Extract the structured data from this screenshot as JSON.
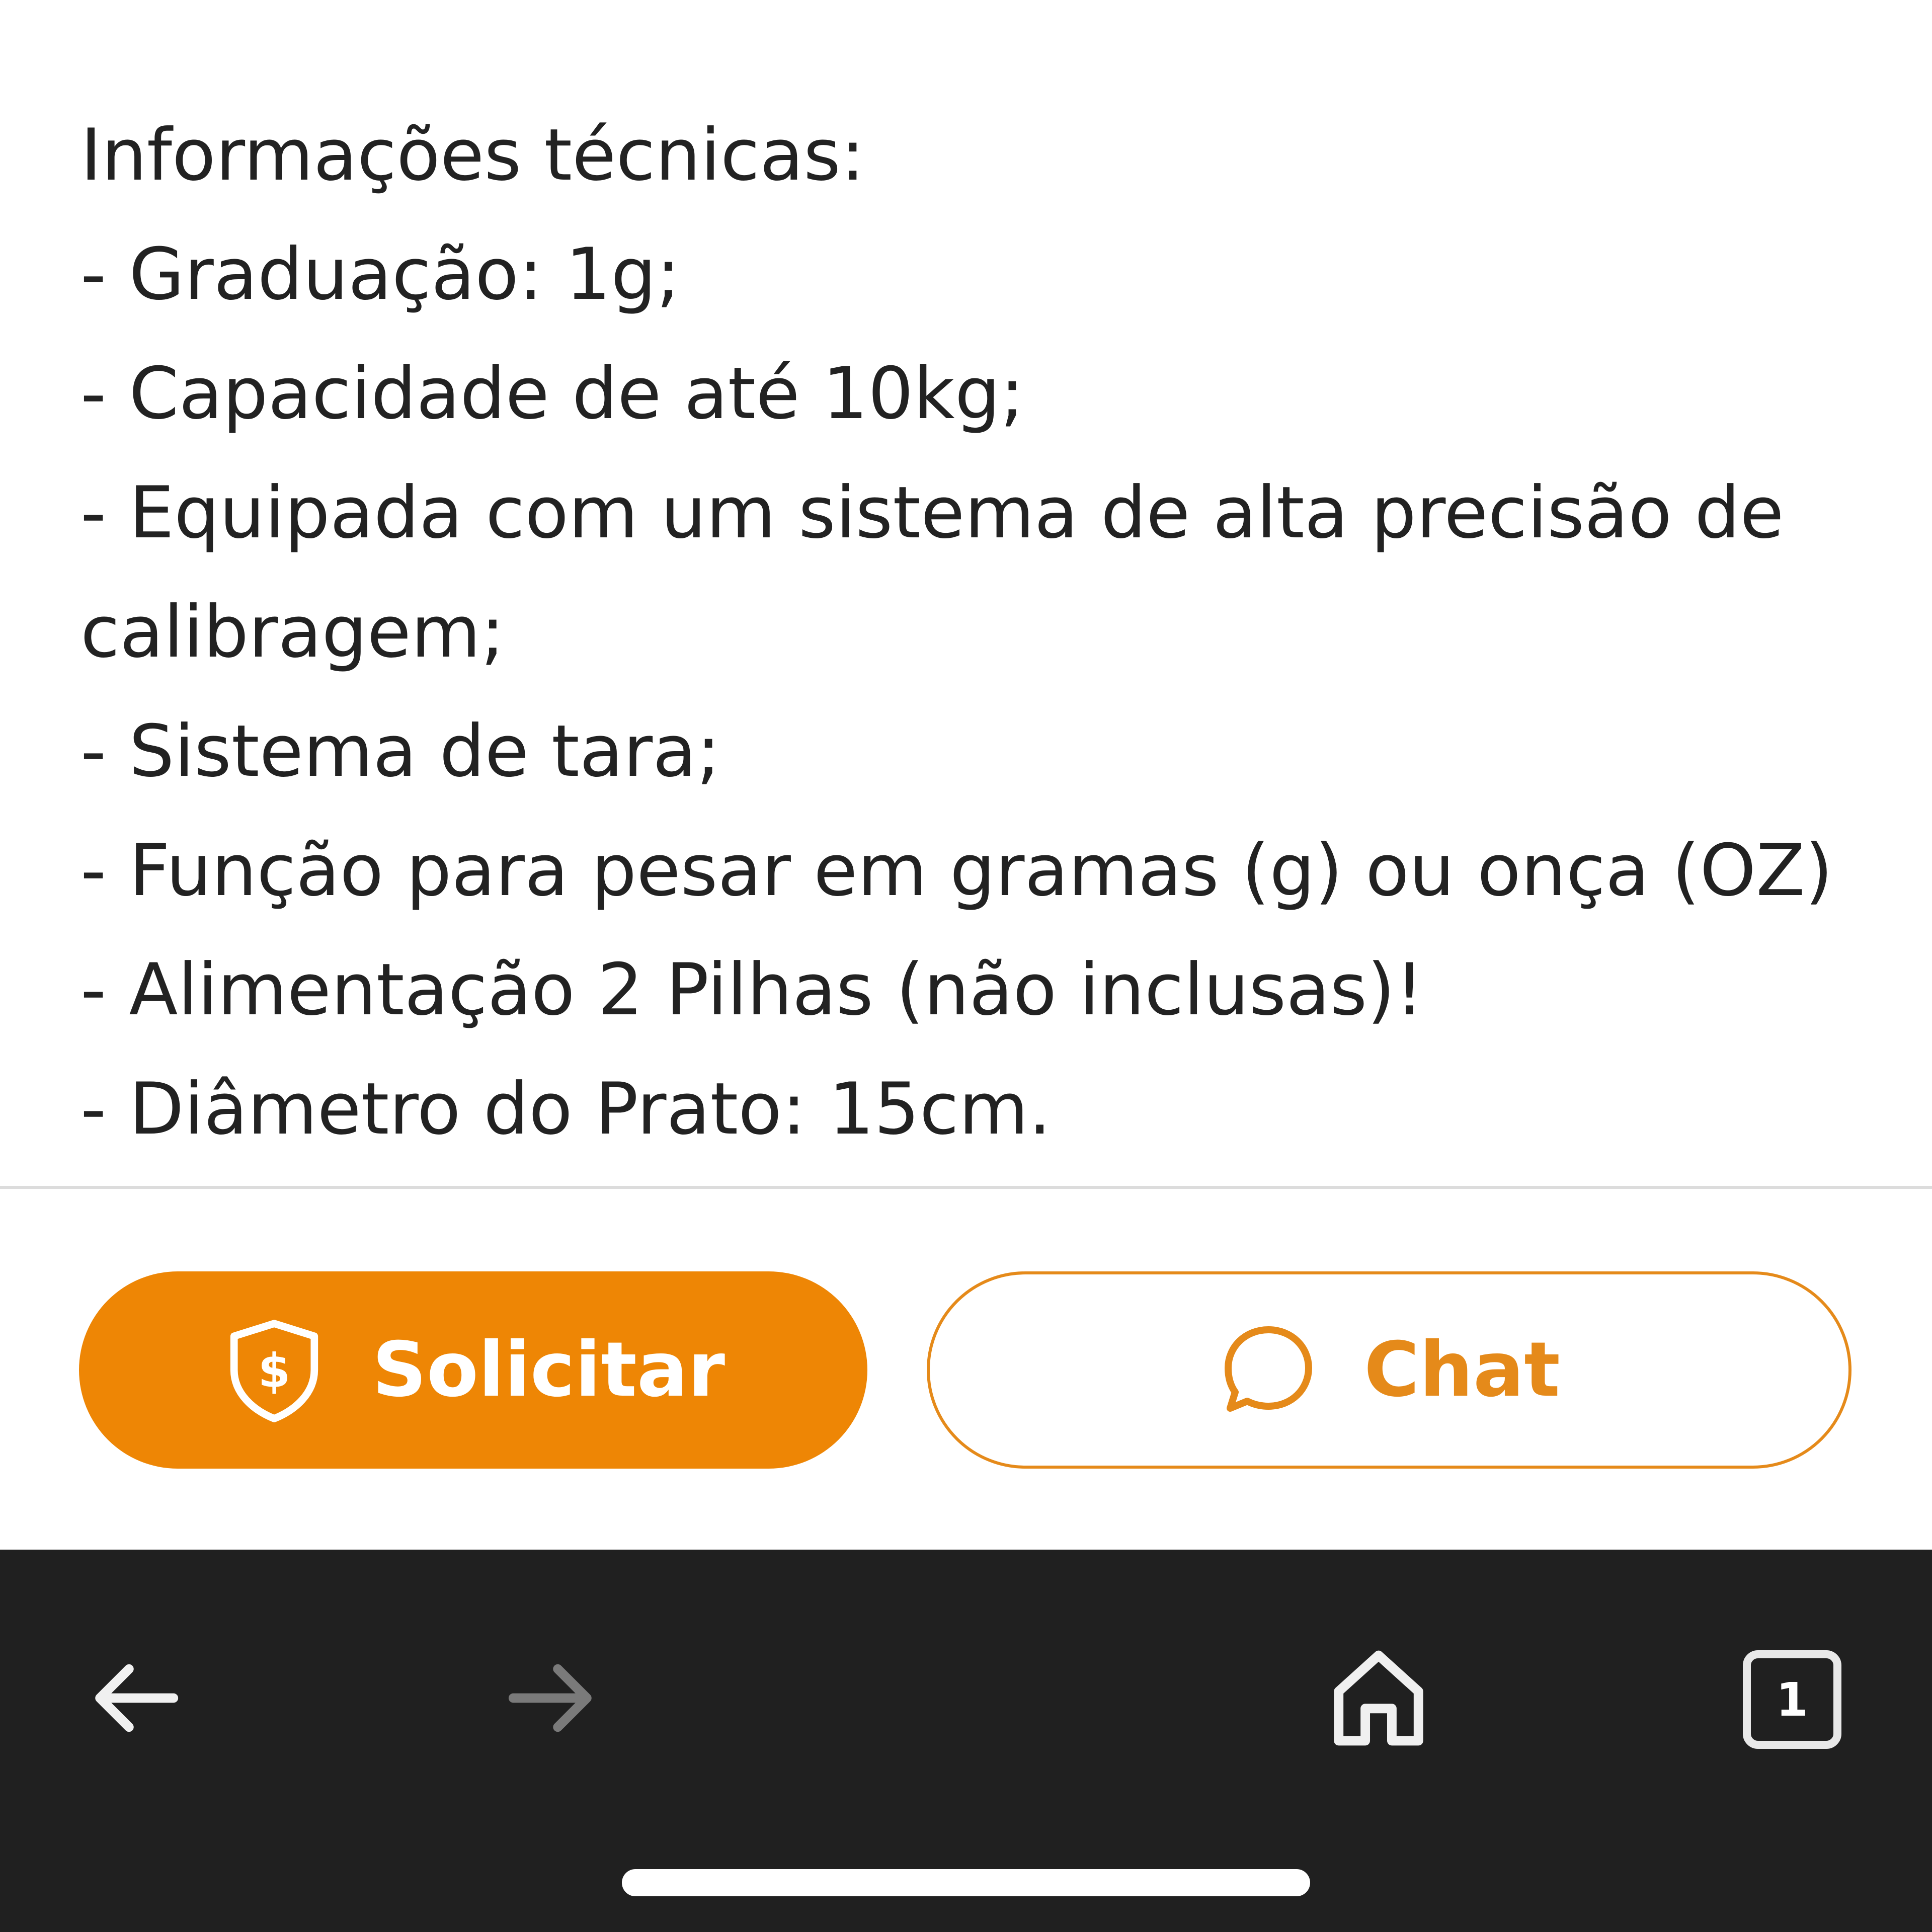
{
  "description": {
    "lines": [
      "Informações técnicas:",
      "- Graduação: 1g;",
      "- Capacidade de até 10kg;",
      "- Equipada com um sistema de alta precisão de calibragem;",
      "- Sistema de tara;",
      "- Função para pesar em gramas (g) ou onça (OZ)",
      "- Alimentação 2 Pilhas (não inclusas)!",
      "- Diâmetro do Prato: 15cm."
    ]
  },
  "actions": {
    "primary_label": "Solicitar",
    "primary_icon": "shield-dollar-icon",
    "secondary_label": "Chat",
    "secondary_icon": "chat-bubble-icon",
    "accent_color": "#ee8605"
  },
  "browser_nav": {
    "back_icon": "arrow-left-icon",
    "forward_icon": "arrow-right-icon",
    "home_icon": "home-icon",
    "tab_count": "1",
    "bar_color": "#202020"
  }
}
